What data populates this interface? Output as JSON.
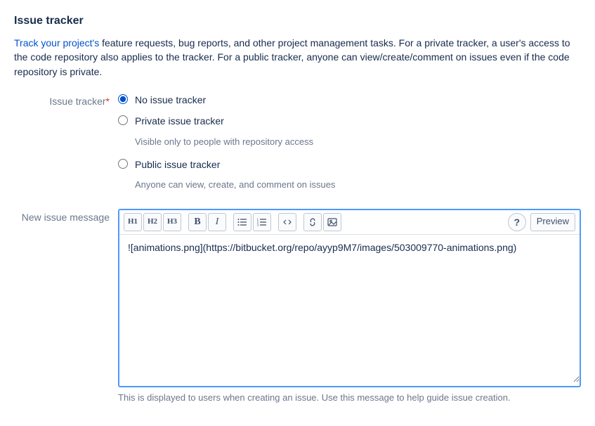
{
  "section": {
    "title": "Issue tracker",
    "link_text": "Track your project's",
    "desc_rest": " feature requests, bug reports, and other project management tasks. For a private tracker, a user's access to the code repository also applies to the tracker. For a public tracker, anyone can view/create/comment on issues even if the code repository is private."
  },
  "tracker_field": {
    "label": "Issue tracker",
    "required_mark": "*",
    "options": [
      {
        "label": "No issue tracker",
        "help": ""
      },
      {
        "label": "Private issue tracker",
        "help": "Visible only to people with repository access"
      },
      {
        "label": "Public issue tracker",
        "help": "Anyone can view, create, and comment on issues"
      }
    ]
  },
  "message_field": {
    "label": "New issue message",
    "toolbar": {
      "h1": "H1",
      "h2": "H2",
      "h3": "H3",
      "bold": "B",
      "italic": "I",
      "help": "?",
      "preview": "Preview"
    },
    "value": "![animations.png](https://bitbucket.org/repo/ayyp9M7/images/503009770-animations.png)",
    "help": "This is displayed to users when creating an issue. Use this message to help guide issue creation."
  }
}
